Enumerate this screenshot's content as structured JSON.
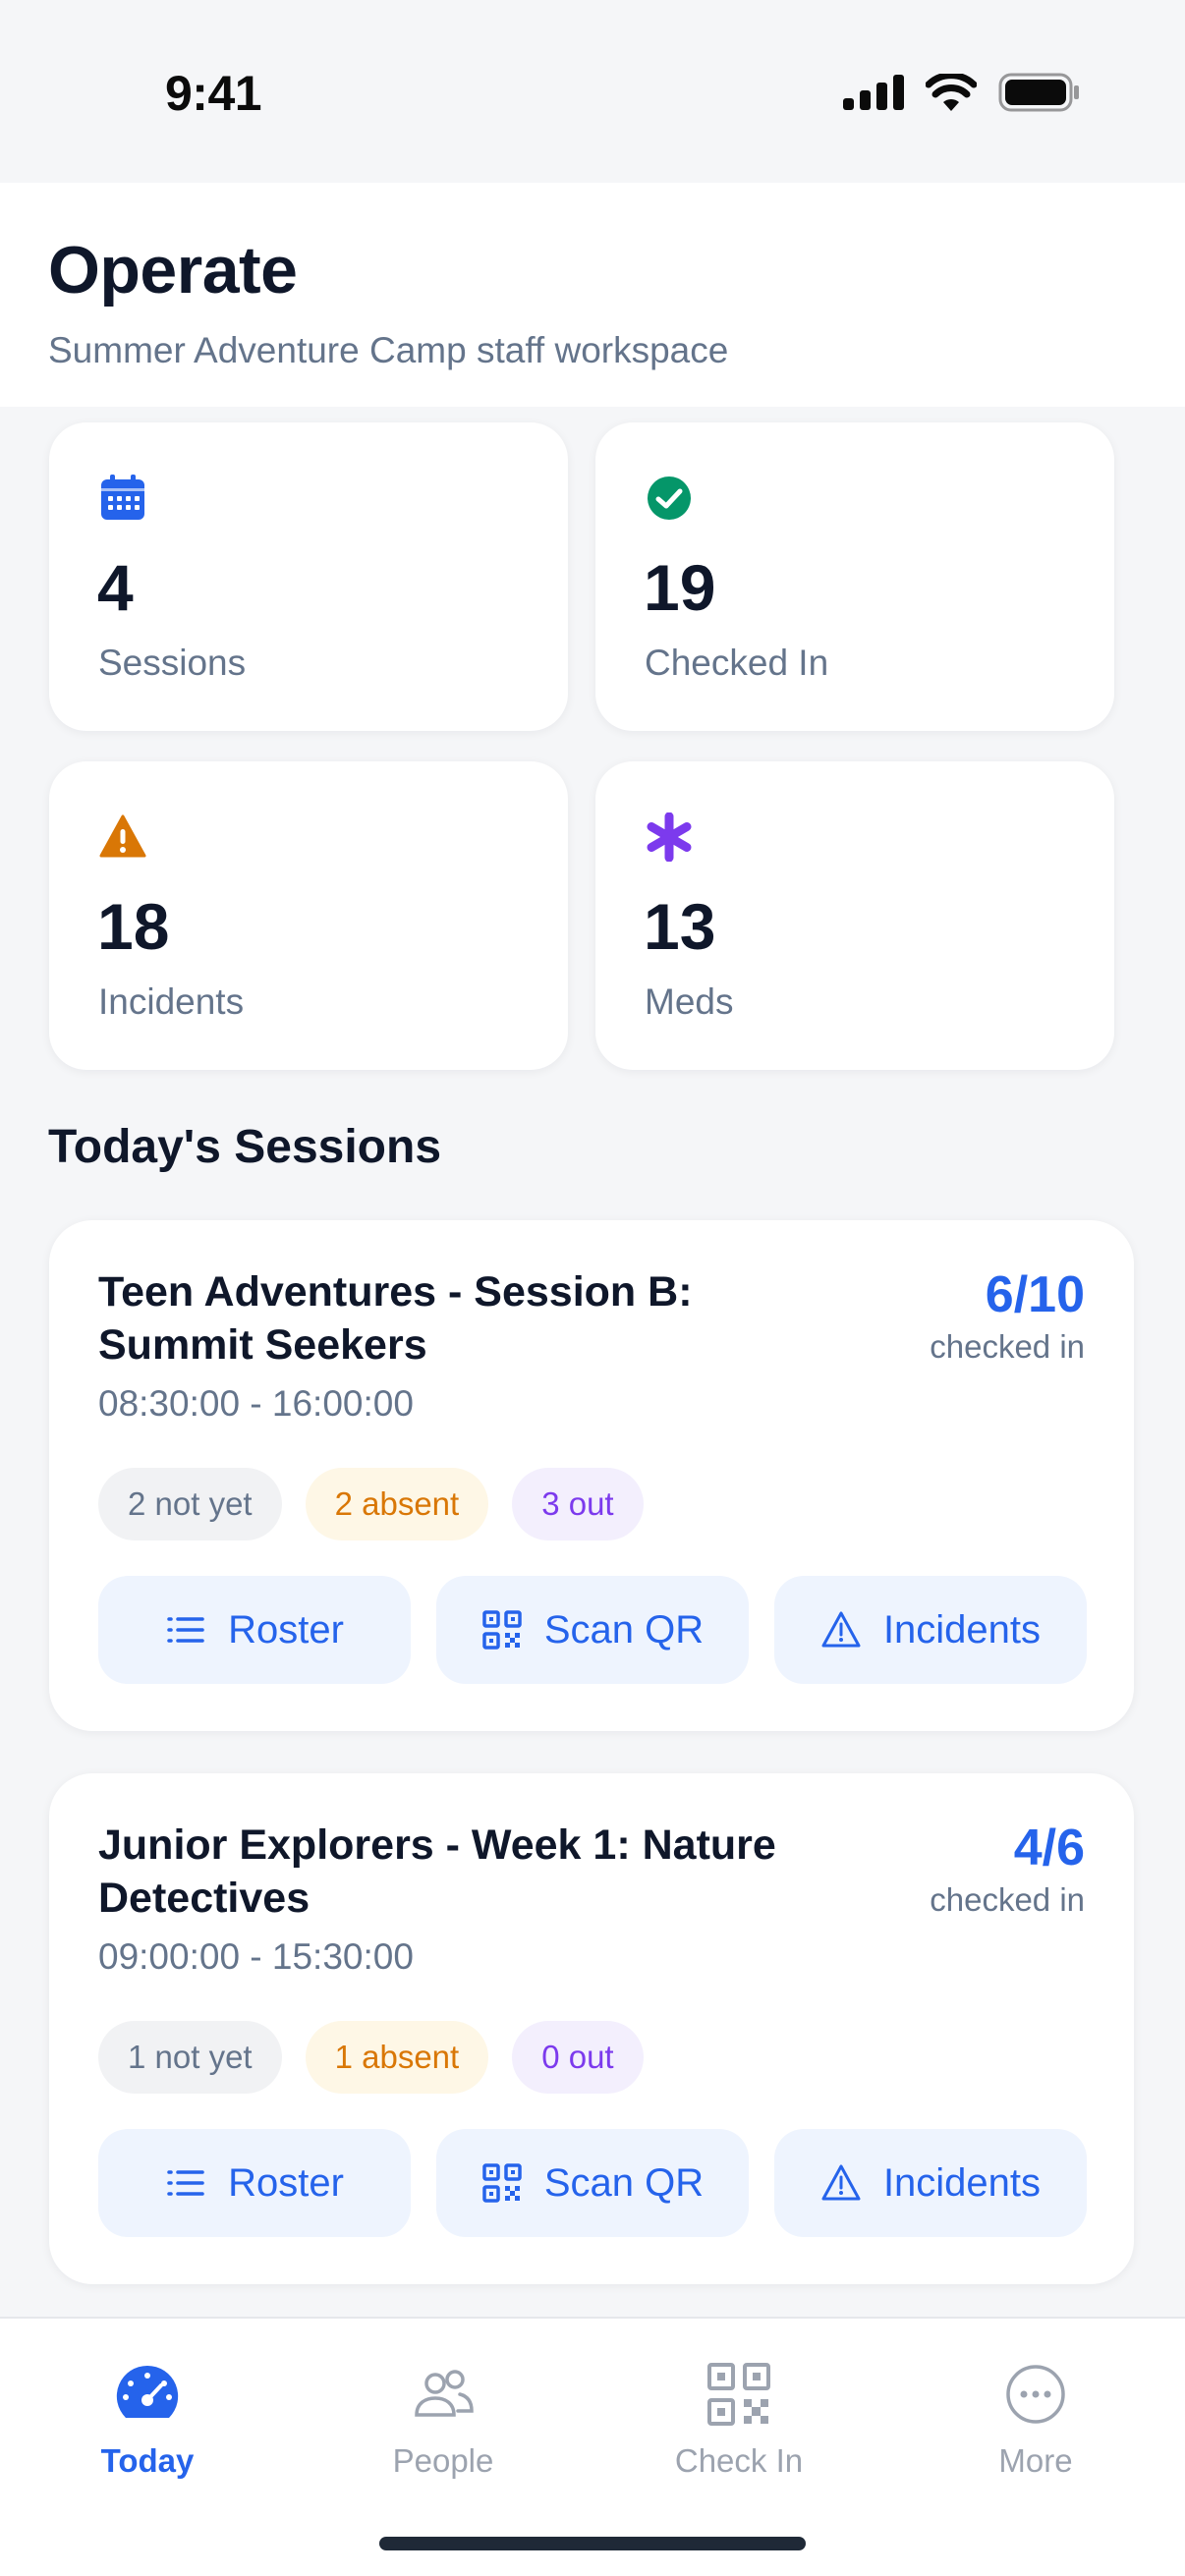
{
  "status_bar": {
    "time": "9:41"
  },
  "header": {
    "title": "Operate",
    "subtitle": "Summer Adventure Camp staff workspace"
  },
  "stats": [
    {
      "value": "4",
      "label": "Sessions",
      "icon": "calendar-icon",
      "color": "#2563eb"
    },
    {
      "value": "19",
      "label": "Checked In",
      "icon": "check-circle-icon",
      "color": "#059669"
    },
    {
      "value": "18",
      "label": "Incidents",
      "icon": "warning-icon",
      "color": "#d97706"
    },
    {
      "value": "13",
      "label": "Meds",
      "icon": "asterisk-icon",
      "color": "#7c3aed"
    }
  ],
  "sessions_section": {
    "title": "Today's Sessions"
  },
  "sessions": [
    {
      "title": "Teen Adventures - Session B: Summit Seekers",
      "time": "08:30:00 - 16:00:00",
      "count": "6/10",
      "count_label": "checked in",
      "not_yet": "2 not yet",
      "absent": "2 absent",
      "out": "3 out",
      "actions": {
        "roster": "Roster",
        "scan": "Scan QR",
        "incidents": "Incidents"
      }
    },
    {
      "title": "Junior Explorers - Week 1: Nature Detectives",
      "time": "09:00:00 - 15:30:00",
      "count": "4/6",
      "count_label": "checked in",
      "not_yet": "1 not yet",
      "absent": "1 absent",
      "out": "0 out",
      "actions": {
        "roster": "Roster",
        "scan": "Scan QR",
        "incidents": "Incidents"
      }
    }
  ],
  "tab_bar": {
    "tabs": [
      {
        "label": "Today",
        "icon": "speedometer-icon",
        "active": true
      },
      {
        "label": "People",
        "icon": "people-icon",
        "active": false
      },
      {
        "label": "Check In",
        "icon": "qr-code-icon",
        "active": false
      },
      {
        "label": "More",
        "icon": "more-icon",
        "active": false
      }
    ]
  },
  "colors": {
    "accent": "#2563eb",
    "success": "#059669",
    "warning": "#d97706",
    "purple": "#7c3aed"
  }
}
